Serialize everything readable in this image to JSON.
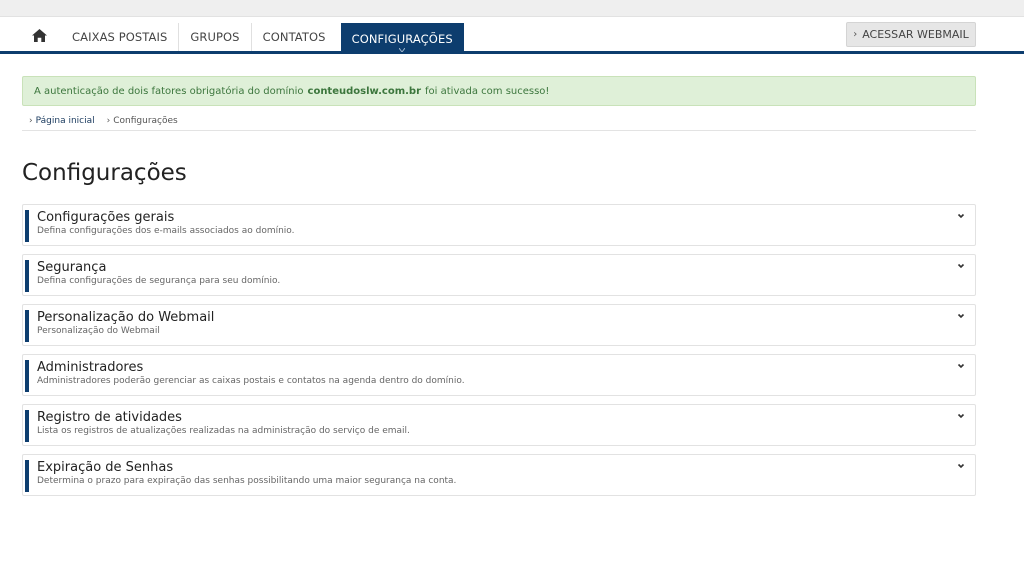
{
  "nav": {
    "home_icon": "home-icon",
    "items": [
      {
        "label": "CAIXAS POSTAIS"
      },
      {
        "label": "GRUPOS"
      },
      {
        "label": "CONTATOS"
      },
      {
        "label": "CONFIGURAÇÕES",
        "active": true
      }
    ],
    "webmail_button": "ACESSAR WEBMAIL",
    "accent_color": "#0d3d6e"
  },
  "alert": {
    "text_before": "A autenticação de dois fatores obrigatória do domínio",
    "domain": "conteudoslw.com.br",
    "text_after": "foi ativada com sucesso!",
    "status": "success",
    "color": "#dff0d8"
  },
  "breadcrumb": [
    {
      "label": "Página inicial"
    },
    {
      "label": "Configurações"
    }
  ],
  "page": {
    "title": "Configurações"
  },
  "sections": [
    {
      "title": "Configurações gerais",
      "subtitle": "Defina configurações dos e-mails associados ao domínio."
    },
    {
      "title": "Segurança",
      "subtitle": "Defina configurações de segurança para seu domínio."
    },
    {
      "title": "Personalização do Webmail",
      "subtitle": "Personalização do Webmail"
    },
    {
      "title": "Administradores",
      "subtitle": "Administradores poderão gerenciar as caixas postais e contatos na agenda dentro do domínio."
    },
    {
      "title": "Registro de atividades",
      "subtitle": "Lista os registros de atualizações realizadas na administração do serviço de email."
    },
    {
      "title": "Expiração de Senhas",
      "subtitle": "Determina o prazo para expiração das senhas possibilitando uma maior segurança na conta."
    }
  ]
}
